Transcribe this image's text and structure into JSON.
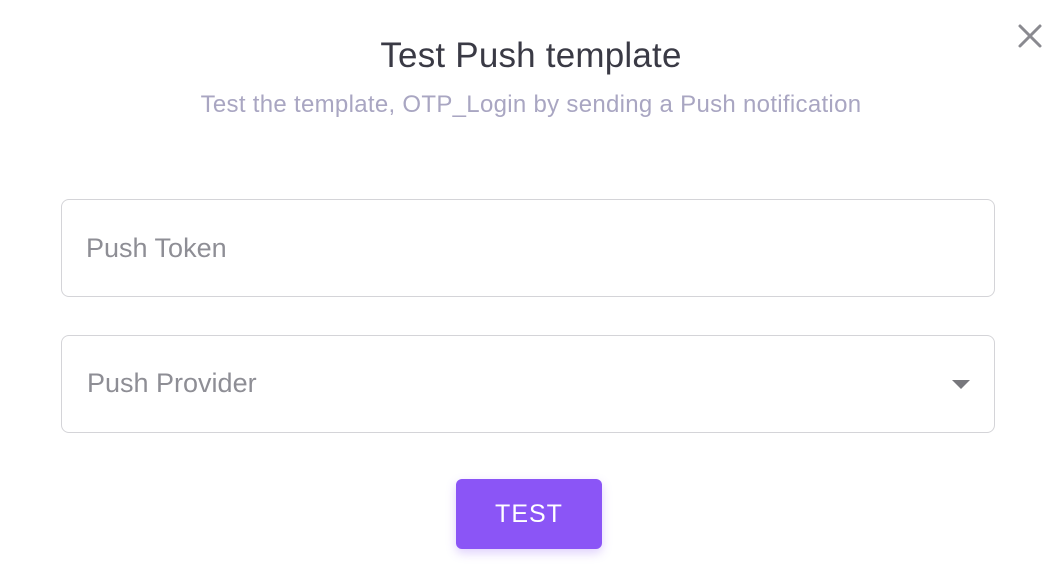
{
  "dialog": {
    "title": "Test Push template",
    "subtitle": "Test the template, OTP_Login by sending a Push notification",
    "close_icon": "close-icon"
  },
  "form": {
    "push_token": {
      "placeholder": "Push Token",
      "value": ""
    },
    "push_provider": {
      "placeholder": "Push Provider",
      "selected": "",
      "icon": "chevron-down-icon"
    },
    "test_button_label": "TEST"
  },
  "colors": {
    "accent": "#8b55f6",
    "title": "#3a3a45",
    "subtitle": "#a9a6c2",
    "border": "#d4d4d8",
    "placeholder": "#8e8e95"
  }
}
